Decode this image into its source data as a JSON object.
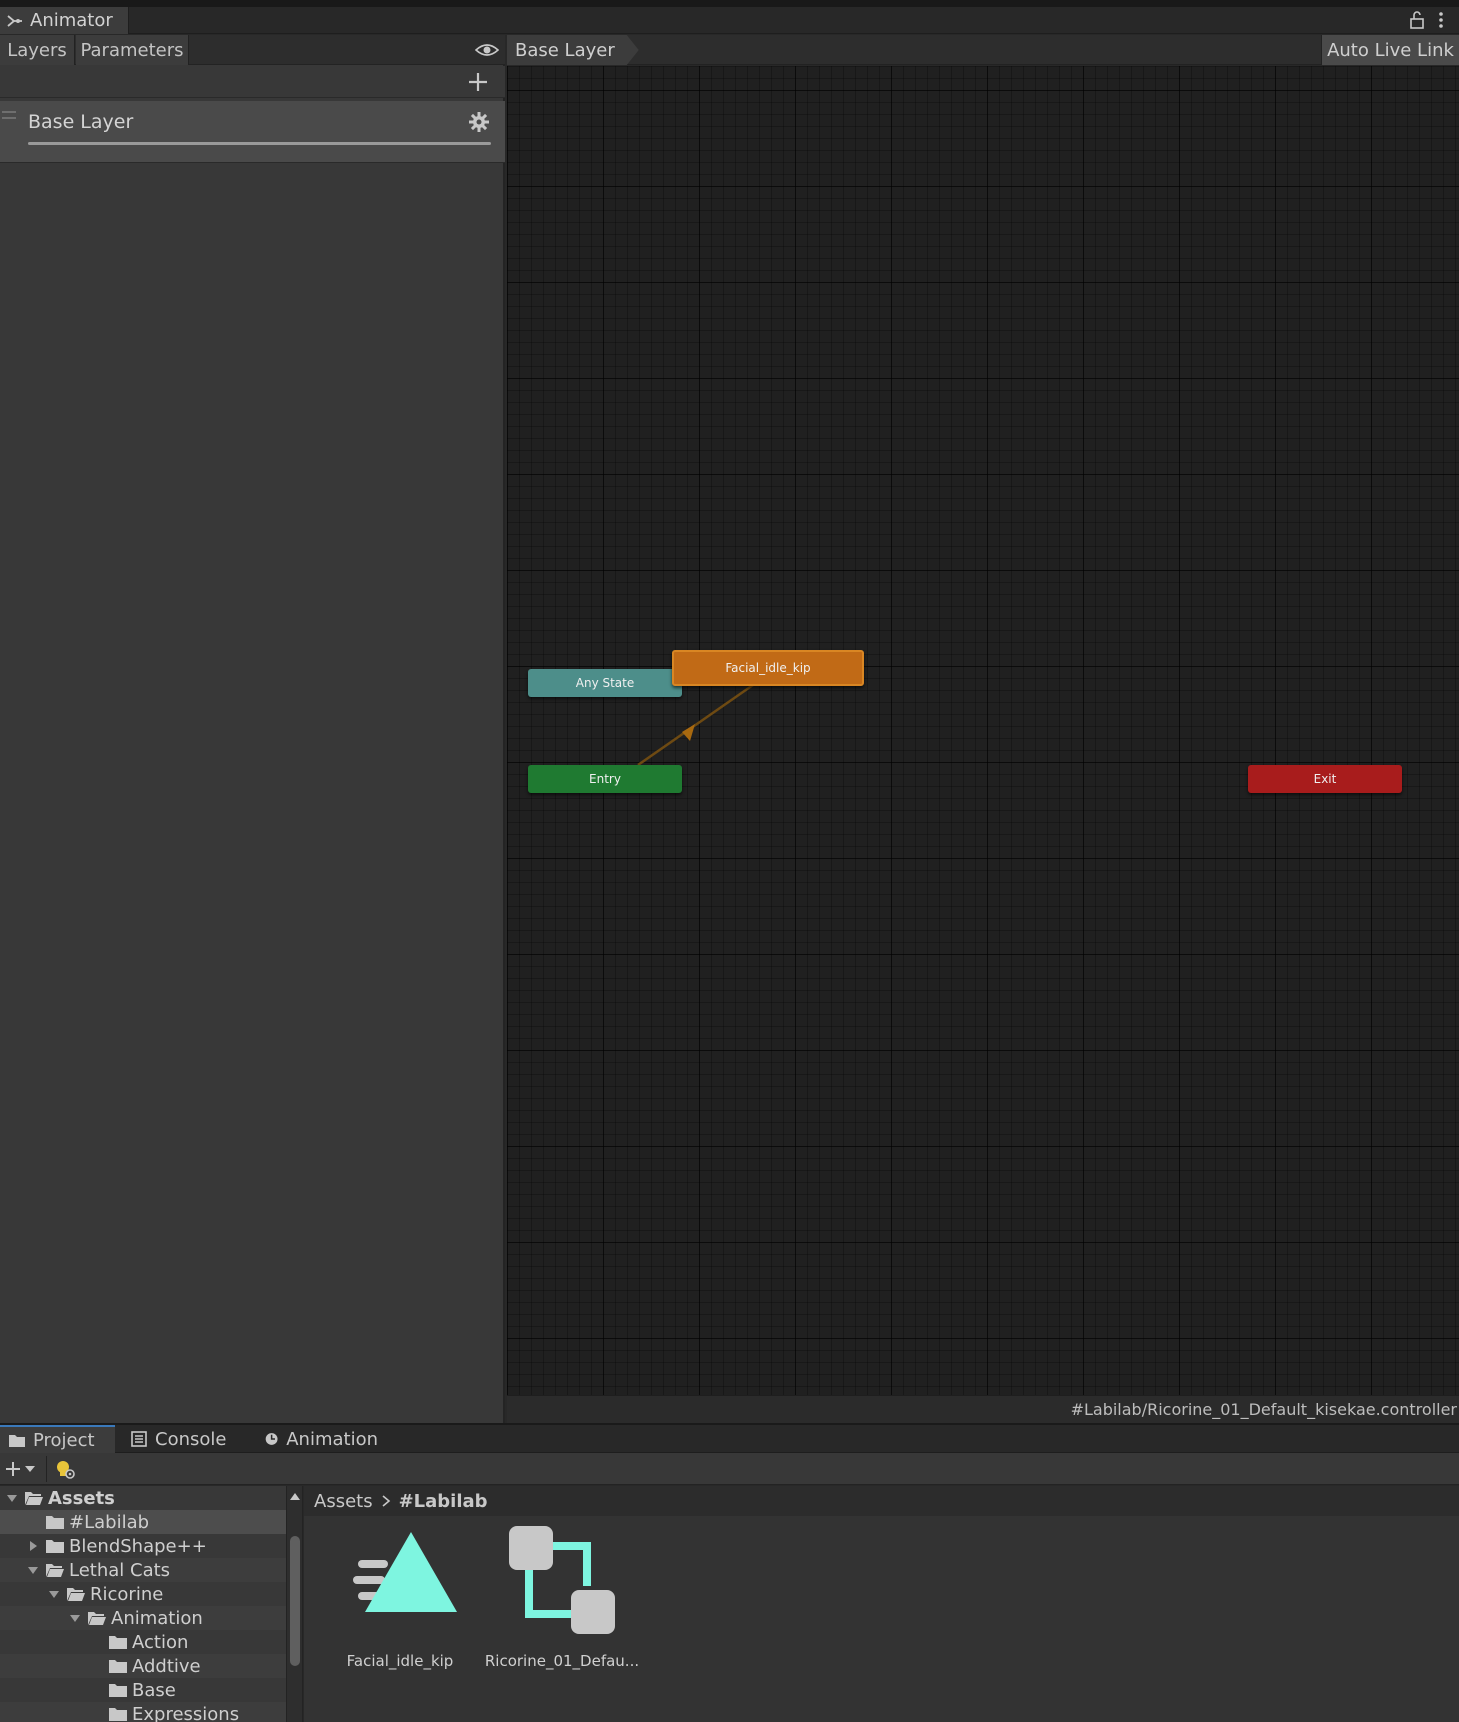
{
  "window": {
    "tab_title": "Animator"
  },
  "left_panel": {
    "tabs": [
      {
        "label": "Layers"
      },
      {
        "label": "Parameters"
      }
    ],
    "layers": [
      {
        "name": "Base Layer"
      }
    ]
  },
  "graph": {
    "breadcrumb": "Base Layer",
    "auto_live_link_label": "Auto Live Link",
    "nodes": {
      "any_state": "Any State",
      "entry": "Entry",
      "exit": "Exit",
      "default_state": "Facial_idle_kip"
    },
    "colors": {
      "any_state": "#4d8e8a",
      "entry": "#1f7a31",
      "exit": "#a81c1c",
      "default_state": "#c16a16"
    },
    "controller_path": "#Labilab/Ricorine_01_Default_kisekae.controller"
  },
  "bottom_tabs": [
    {
      "label": "Project",
      "icon": "folder-icon",
      "active": true
    },
    {
      "label": "Console",
      "icon": "console-icon",
      "active": false
    },
    {
      "label": "Animation",
      "icon": "clock-icon",
      "active": false
    }
  ],
  "project": {
    "tree": [
      {
        "label": "Assets",
        "depth": 0,
        "expanded": true,
        "has_children": true,
        "bold": true
      },
      {
        "label": "#Labilab",
        "depth": 1,
        "expanded": false,
        "has_children": false,
        "selected": true
      },
      {
        "label": "BlendShape++",
        "depth": 1,
        "expanded": false,
        "has_children": true
      },
      {
        "label": "Lethal Cats",
        "depth": 1,
        "expanded": true,
        "has_children": true
      },
      {
        "label": "Ricorine",
        "depth": 2,
        "expanded": true,
        "has_children": true
      },
      {
        "label": "Animation",
        "depth": 3,
        "expanded": true,
        "has_children": true
      },
      {
        "label": "Action",
        "depth": 4,
        "expanded": false,
        "has_children": false
      },
      {
        "label": "Addtive",
        "depth": 4,
        "expanded": false,
        "has_children": false
      },
      {
        "label": "Base",
        "depth": 4,
        "expanded": false,
        "has_children": false
      },
      {
        "label": "Expressions",
        "depth": 4,
        "expanded": false,
        "has_children": false
      }
    ],
    "breadcrumb": {
      "root": "Assets",
      "current": "#Labilab"
    },
    "assets": [
      {
        "label": "Facial_idle_kip",
        "icon": "animation-clip-icon"
      },
      {
        "label": "Ricorine_01_Defau...",
        "icon": "animator-controller-icon"
      }
    ],
    "accent_color": "#7ef5e0"
  }
}
